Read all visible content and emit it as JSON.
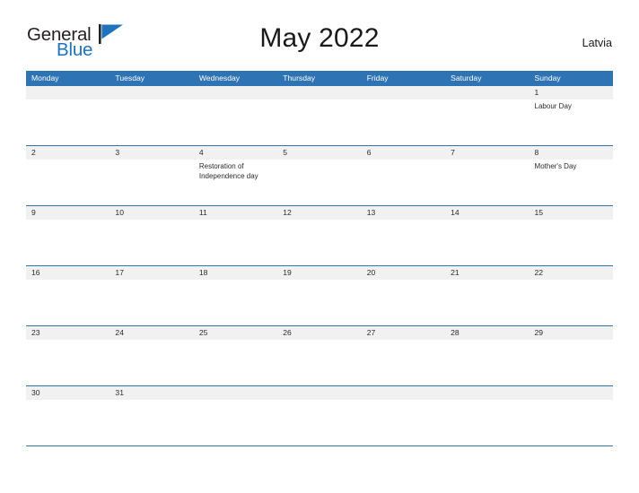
{
  "brand": {
    "name_part1": "General",
    "name_part2": "Blue",
    "flag_icon": "triangle-flag-icon"
  },
  "header": {
    "title": "May 2022",
    "country": "Latvia"
  },
  "colors": {
    "header_blue": "#2e73b3",
    "band_gray": "#f1f1f1",
    "logo_blue": "#1f72bd",
    "text_dark": "#2b2b2b"
  },
  "calendar": {
    "weekdays": [
      "Monday",
      "Tuesday",
      "Wednesday",
      "Thursday",
      "Friday",
      "Saturday",
      "Sunday"
    ],
    "weeks": [
      [
        {
          "day": ""
        },
        {
          "day": ""
        },
        {
          "day": ""
        },
        {
          "day": ""
        },
        {
          "day": ""
        },
        {
          "day": ""
        },
        {
          "day": "1",
          "events": [
            "Labour Day"
          ]
        }
      ],
      [
        {
          "day": "2"
        },
        {
          "day": "3"
        },
        {
          "day": "4",
          "events": [
            "Restoration of Independence day"
          ]
        },
        {
          "day": "5"
        },
        {
          "day": "6"
        },
        {
          "day": "7"
        },
        {
          "day": "8",
          "events": [
            "Mother's Day"
          ]
        }
      ],
      [
        {
          "day": "9"
        },
        {
          "day": "10"
        },
        {
          "day": "11"
        },
        {
          "day": "12"
        },
        {
          "day": "13"
        },
        {
          "day": "14"
        },
        {
          "day": "15"
        }
      ],
      [
        {
          "day": "16"
        },
        {
          "day": "17"
        },
        {
          "day": "18"
        },
        {
          "day": "19"
        },
        {
          "day": "20"
        },
        {
          "day": "21"
        },
        {
          "day": "22"
        }
      ],
      [
        {
          "day": "23"
        },
        {
          "day": "24"
        },
        {
          "day": "25"
        },
        {
          "day": "26"
        },
        {
          "day": "27"
        },
        {
          "day": "28"
        },
        {
          "day": "29"
        }
      ],
      [
        {
          "day": "30"
        },
        {
          "day": "31"
        },
        {
          "day": ""
        },
        {
          "day": ""
        },
        {
          "day": ""
        },
        {
          "day": ""
        },
        {
          "day": ""
        }
      ]
    ]
  }
}
